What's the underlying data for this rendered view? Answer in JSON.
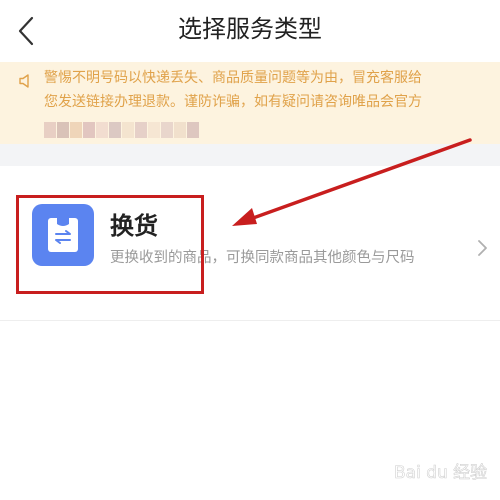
{
  "header": {
    "title": "选择服务类型",
    "back_icon": "chevron-left-icon"
  },
  "notice": {
    "icon": "speaker-icon",
    "line1": "警惕不明号码以快递丢失、商品质量问题等为由，冒充客服给",
    "line2": "您发送链接办理退款。谨防诈骗，如有疑问请咨询唯品会官方"
  },
  "service": {
    "icon": "exchange-bag-icon",
    "title": "换货",
    "description": "更换收到的商品，可换同款商品其他颜色与尺码"
  },
  "colors": {
    "notice_text": "#e0a24a",
    "notice_bg": "#fdf3df",
    "icon_bg": "#5b84f0",
    "annotation": "#c81e1e"
  },
  "watermark": {
    "text": "Bai du 经验"
  }
}
